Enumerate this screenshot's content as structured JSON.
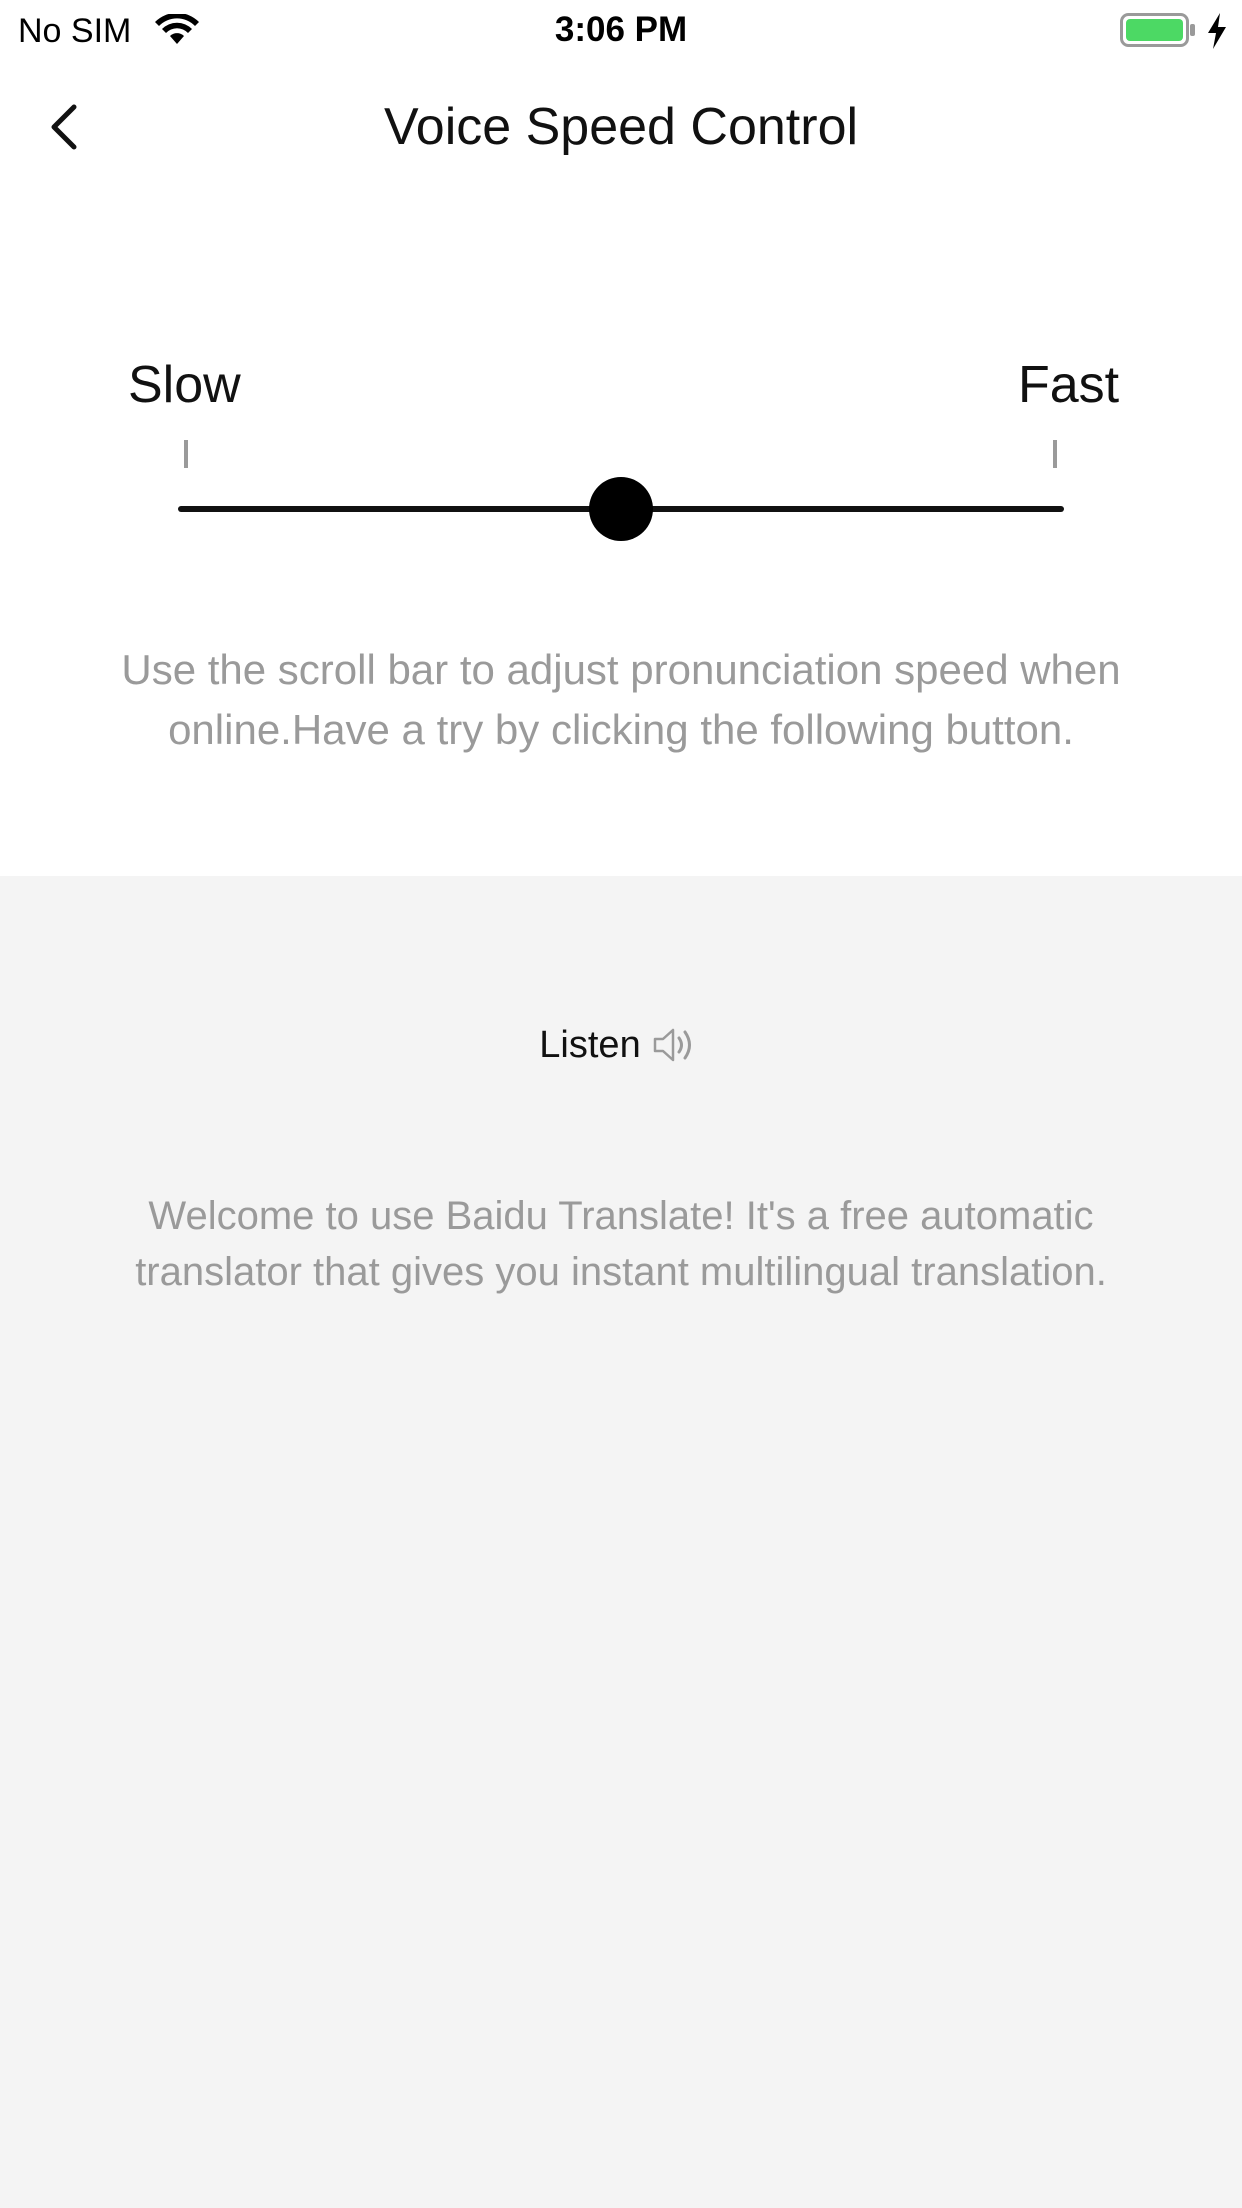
{
  "status_bar": {
    "carrier": "No SIM",
    "time": "3:06 PM",
    "wifi_icon": "wifi-icon",
    "battery_icon": "battery-icon",
    "charging_icon": "charging-bolt-icon",
    "battery_color": "#4cd964"
  },
  "nav": {
    "back_icon": "chevron-left-icon",
    "title": "Voice Speed Control"
  },
  "speed_control": {
    "min_label": "Slow",
    "max_label": "Fast",
    "value_fraction": 0.5,
    "instructions": "Use the scroll bar to adjust pronunciation speed when online.Have a try by clicking the following button."
  },
  "listen": {
    "label": "Listen",
    "icon": "speaker-icon"
  },
  "sample_text": "Welcome to use Baidu Translate! It's a free automatic translator that gives you instant multilingual translation.",
  "colors": {
    "top_background": "#ffffff",
    "bottom_background": "#f4f4f4",
    "hint_text": "#9a9a9a",
    "primary_text": "#111111"
  }
}
